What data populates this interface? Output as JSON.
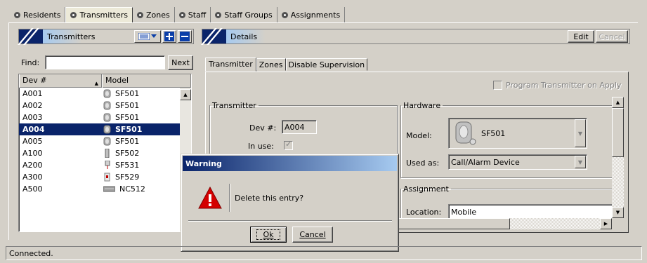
{
  "main_tabs": [
    {
      "label": "Residents",
      "icon": "bullet-icon",
      "active": false
    },
    {
      "label": "Transmitters",
      "icon": "bullet-icon",
      "active": true
    },
    {
      "label": "Zones",
      "icon": "bullet-icon",
      "active": false
    },
    {
      "label": "Staff",
      "icon": "bullet-icon",
      "active": false
    },
    {
      "label": "Staff Groups",
      "icon": "bullet-icon",
      "active": false
    },
    {
      "label": "Assignments",
      "icon": "bullet-icon",
      "active": false
    }
  ],
  "left_pane": {
    "title": "Transmitters",
    "find_label": "Find:",
    "find_value": "",
    "next_button": "Next",
    "columns": [
      "Dev #",
      "Model"
    ],
    "rows": [
      {
        "dev": "A001",
        "model": "SF501",
        "icon": "pendant-icon",
        "selected": false
      },
      {
        "dev": "A002",
        "model": "SF501",
        "icon": "pendant-icon",
        "selected": false
      },
      {
        "dev": "A003",
        "model": "SF501",
        "icon": "pendant-icon",
        "selected": false
      },
      {
        "dev": "A004",
        "model": "SF501",
        "icon": "pendant-icon",
        "selected": true
      },
      {
        "dev": "A005",
        "model": "SF501",
        "icon": "pendant-icon",
        "selected": false
      },
      {
        "dev": "A100",
        "model": "SF502",
        "icon": "slim-transmitter-icon",
        "selected": false
      },
      {
        "dev": "A200",
        "model": "SF531",
        "icon": "pull-cord-icon",
        "selected": false
      },
      {
        "dev": "A300",
        "model": "SF529",
        "icon": "door-sensor-icon",
        "selected": false
      },
      {
        "dev": "A500",
        "model": "NC512",
        "icon": "bed-sensor-icon",
        "selected": false
      }
    ]
  },
  "right_pane": {
    "title": "Details",
    "edit_button": "Edit",
    "cancel_button": "Cancel",
    "tabs": [
      "Transmitter",
      "Zones",
      "Disable Supervision"
    ],
    "program_checkbox_label": "Program Transmitter on Apply",
    "transmitter_group": {
      "legend": "Transmitter",
      "dev_label": "Dev #:",
      "dev_value": "A004",
      "in_use_label": "In use:"
    },
    "hardware_group": {
      "legend": "Hardware",
      "model_label": "Model:",
      "model_value": "SF501",
      "used_as_label": "Used as:",
      "used_as_value": "Call/Alarm Device"
    },
    "assignment_group": {
      "legend": "Assignment",
      "location_label": "Location:",
      "location_value": "Mobile"
    }
  },
  "dialog": {
    "title": "Warning",
    "message": "Delete this entry?",
    "ok_button": "Ok",
    "cancel_button": "Cancel"
  },
  "status": "Connected.",
  "colors": {
    "window_bg": "#d4d0c8",
    "selection": "#0a246a",
    "title_gradient_start": "#0a246a",
    "title_gradient_end": "#a6caf0",
    "warning_red": "#d40000"
  }
}
